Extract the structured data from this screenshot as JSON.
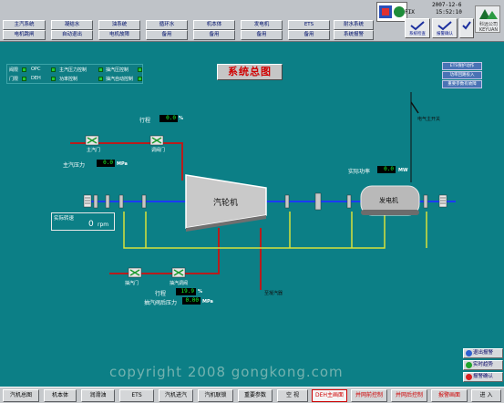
{
  "top_nav": {
    "row1": [
      "主汽系统",
      "凝结水",
      "油系统",
      "循环水",
      "机本体",
      "发电机",
      "ETS",
      "耐水系统"
    ],
    "row2": [
      "电机跳闸",
      "自动退出",
      "电机故障",
      "备用",
      "备用",
      "备用",
      "备用",
      "系统报警"
    ]
  },
  "top_status": {
    "fix_label": "FIX",
    "date": "2007-12-6",
    "time": "15:52:10",
    "small_buttons": [
      "系统检查",
      "报警确认",
      "系统手动"
    ],
    "company": [
      "科远公司",
      "KEYUAN"
    ]
  },
  "status_panel": {
    "col1": [
      "阀限",
      "门限"
    ],
    "col2": [
      "OPC",
      "DEH"
    ],
    "col3": [
      "主汽压力控制",
      "功率控制"
    ],
    "col4": [
      "抽汽压控制",
      "抽汽自动控制"
    ]
  },
  "page_title": "系统总图",
  "right_panel": [
    "ETS保护动作",
    "功率回路投入",
    "重要参数有故障"
  ],
  "readouts": {
    "stroke_top_label": "行程",
    "stroke_top_value": "0.0",
    "stroke_top_unit": "%",
    "main_pressure_label": "主汽压力",
    "main_pressure_value": "0.0",
    "main_pressure_unit": "MPa",
    "actual_power_label": "实际功率",
    "actual_power_value": "0.0",
    "actual_power_unit": "MW",
    "actual_speed_label": "实际转速",
    "actual_speed_value": "0",
    "actual_speed_unit": "rpm",
    "stroke_bottom_label": "行程",
    "stroke_bottom_value": "19.9",
    "stroke_bottom_unit": "%",
    "extract_pressure_label": "抽汽阀后压力",
    "extract_pressure_value": "0.00",
    "extract_pressure_unit": "MPa"
  },
  "diagram": {
    "turbine_label": "汽轮机",
    "generator_label": "发电机",
    "main_valve_label": "主汽门",
    "regulating_valve_label": "调阀门",
    "extract_gate_label": "抽汽门",
    "extract_valve_label": "抽汽调阀",
    "breaker_label": "电气主开关",
    "condenser_label": "至凝汽器"
  },
  "side_buttons": [
    "退出报警",
    "实时趋势",
    "报警确认"
  ],
  "bottom_nav": [
    "汽机总图",
    "机本体",
    "润滑油",
    "ETS",
    "汽机进汽",
    "汽机联锁",
    "重要参数",
    "空 视",
    "DEH主画面",
    "并网前控制",
    "并网后控制",
    "报警画面",
    "进 入"
  ],
  "watermark": "copyright 2008 gongkong.com",
  "colors": {
    "background": "#0c7f86",
    "steam_line": "#b81c1c",
    "shaft_line": "#1b3aff",
    "oil_line": "#d6e23a",
    "readout_text": "#17ff2c"
  }
}
